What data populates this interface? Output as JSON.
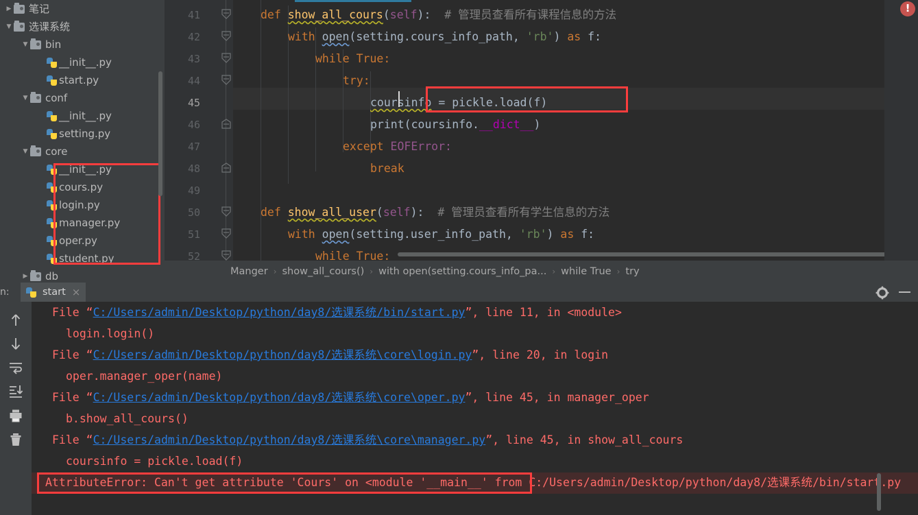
{
  "project_tree": {
    "items": [
      {
        "label": "笔记",
        "indent": 0,
        "twisty": "collapsed",
        "icon": "folder-icon"
      },
      {
        "label": "选课系统",
        "indent": 0,
        "twisty": "expanded",
        "icon": "folder-icon"
      },
      {
        "label": "bin",
        "indent": 1,
        "twisty": "expanded",
        "icon": "folder-icon"
      },
      {
        "label": "__init__.py",
        "indent": 2,
        "twisty": "none",
        "icon": "python-file-icon"
      },
      {
        "label": "start.py",
        "indent": 2,
        "twisty": "none",
        "icon": "python-file-icon"
      },
      {
        "label": "conf",
        "indent": 1,
        "twisty": "expanded",
        "icon": "folder-icon"
      },
      {
        "label": "__init__.py",
        "indent": 2,
        "twisty": "none",
        "icon": "python-file-icon"
      },
      {
        "label": "setting.py",
        "indent": 2,
        "twisty": "none",
        "icon": "python-file-icon"
      },
      {
        "label": "core",
        "indent": 1,
        "twisty": "expanded",
        "icon": "folder-icon"
      },
      {
        "label": "__init__.py",
        "indent": 2,
        "twisty": "none",
        "icon": "python-file-icon"
      },
      {
        "label": "cours.py",
        "indent": 2,
        "twisty": "none",
        "icon": "python-file-icon"
      },
      {
        "label": "login.py",
        "indent": 2,
        "twisty": "none",
        "icon": "python-file-icon"
      },
      {
        "label": "manager.py",
        "indent": 2,
        "twisty": "none",
        "icon": "python-file-icon"
      },
      {
        "label": "oper.py",
        "indent": 2,
        "twisty": "none",
        "icon": "python-file-icon"
      },
      {
        "label": "student.py",
        "indent": 2,
        "twisty": "none",
        "icon": "python-file-icon"
      },
      {
        "label": "db",
        "indent": 1,
        "twisty": "collapsed",
        "icon": "folder-icon"
      }
    ]
  },
  "editor": {
    "line_numbers": [
      "41",
      "42",
      "43",
      "44",
      "45",
      "46",
      "47",
      "48",
      "49",
      "50",
      "51",
      "52"
    ],
    "current_line": "45",
    "code_lines": [
      {
        "n": "41",
        "indent": 4,
        "segments": [
          {
            "t": "def ",
            "c": "kw"
          },
          {
            "t": "show_all_cours",
            "c": "fn squig"
          },
          {
            "t": "(",
            "c": "def"
          },
          {
            "t": "self",
            "c": "slf"
          },
          {
            "t": "):  ",
            "c": "def"
          },
          {
            "t": "# 管理员查看所有课程信息的方法",
            "c": "cmt"
          }
        ]
      },
      {
        "n": "42",
        "indent": 8,
        "segments": [
          {
            "t": "with ",
            "c": "kw"
          },
          {
            "t": "open",
            "c": "squig-w"
          },
          {
            "t": "(setting.cours_info_path, ",
            "c": "def"
          },
          {
            "t": "'rb'",
            "c": "str"
          },
          {
            "t": ") ",
            "c": "def"
          },
          {
            "t": "as ",
            "c": "kw"
          },
          {
            "t": "f:",
            "c": "def"
          }
        ]
      },
      {
        "n": "43",
        "indent": 12,
        "segments": [
          {
            "t": "while ",
            "c": "kw"
          },
          {
            "t": "True:",
            "c": "kw"
          }
        ]
      },
      {
        "n": "44",
        "indent": 16,
        "segments": [
          {
            "t": "try:",
            "c": "kw"
          }
        ]
      },
      {
        "n": "45",
        "indent": 20,
        "segments": [
          {
            "t": "coursinfo",
            "c": "def squig"
          },
          {
            "t": " = pickle.",
            "c": "def"
          },
          {
            "t": "load",
            "c": "def"
          },
          {
            "t": "(f)",
            "c": "def"
          }
        ]
      },
      {
        "n": "46",
        "indent": 20,
        "segments": [
          {
            "t": "print",
            "c": "def"
          },
          {
            "t": "(coursinfo.",
            "c": "def"
          },
          {
            "t": "__dict__",
            "c": "mag"
          },
          {
            "t": ")",
            "c": "def"
          }
        ]
      },
      {
        "n": "47",
        "indent": 16,
        "segments": [
          {
            "t": "except ",
            "c": "kw"
          },
          {
            "t": "EOFError:",
            "c": "slf"
          }
        ]
      },
      {
        "n": "48",
        "indent": 20,
        "segments": [
          {
            "t": "break",
            "c": "kw"
          }
        ]
      },
      {
        "n": "49",
        "indent": 0,
        "segments": []
      },
      {
        "n": "50",
        "indent": 4,
        "segments": [
          {
            "t": "def ",
            "c": "kw"
          },
          {
            "t": "show_all_user",
            "c": "fn squig"
          },
          {
            "t": "(",
            "c": "def"
          },
          {
            "t": "self",
            "c": "slf"
          },
          {
            "t": "):  ",
            "c": "def"
          },
          {
            "t": "# 管理员查看所有学生信息的方法",
            "c": "cmt"
          }
        ]
      },
      {
        "n": "51",
        "indent": 8,
        "segments": [
          {
            "t": "with ",
            "c": "kw"
          },
          {
            "t": "open",
            "c": "squig-w"
          },
          {
            "t": "(setting.user_info_path, ",
            "c": "def"
          },
          {
            "t": "'rb'",
            "c": "str"
          },
          {
            "t": ") ",
            "c": "def"
          },
          {
            "t": "as ",
            "c": "kw"
          },
          {
            "t": "f:",
            "c": "def"
          }
        ]
      },
      {
        "n": "52",
        "indent": 12,
        "segments": [
          {
            "t": "while ",
            "c": "kw"
          },
          {
            "t": "True:",
            "c": "kw"
          }
        ]
      }
    ],
    "error_badge_count": "!",
    "highlight_color": "#fc3d3d"
  },
  "breadcrumb": {
    "parts": [
      "Manger",
      "show_all_cours()",
      "with open(setting.cours_info_pa...",
      "while True",
      "try"
    ],
    "separator": "›"
  },
  "console": {
    "run_label": "n:",
    "tab_label": "start",
    "tab_close": "×",
    "gear_icon": "gear-icon",
    "minimize_icon": "minimize-icon",
    "toolbar_icons": [
      "arrow-up-icon",
      "arrow-down-icon",
      "soft-wrap-icon",
      "scroll-to-end-icon",
      "print-icon",
      "trash-icon"
    ],
    "lines": [
      {
        "indent": 2,
        "segments": [
          {
            "t": "File ",
            "c": "c-red"
          },
          {
            "t": "“",
            "c": "c-red"
          },
          {
            "t": "C:/Users/admin/Desktop/python/day8/选课系统/bin/start.py",
            "c": "c-link"
          },
          {
            "t": "”, line 11, in <module>",
            "c": "c-red"
          }
        ]
      },
      {
        "indent": 4,
        "segments": [
          {
            "t": "login.login()",
            "c": "c-red"
          }
        ]
      },
      {
        "indent": 2,
        "segments": [
          {
            "t": "File ",
            "c": "c-red"
          },
          {
            "t": "“",
            "c": "c-red"
          },
          {
            "t": "C:/Users/admin/Desktop/python/day8/选课系统\\core\\login.py",
            "c": "c-link"
          },
          {
            "t": "”, line 20, in login",
            "c": "c-red"
          }
        ]
      },
      {
        "indent": 4,
        "segments": [
          {
            "t": "oper.manager_oper(name)",
            "c": "c-red"
          }
        ]
      },
      {
        "indent": 2,
        "segments": [
          {
            "t": "File ",
            "c": "c-red"
          },
          {
            "t": "“",
            "c": "c-red"
          },
          {
            "t": "C:/Users/admin/Desktop/python/day8/选课系统\\core\\oper.py",
            "c": "c-link"
          },
          {
            "t": "”, line 45, in manager_oper",
            "c": "c-red"
          }
        ]
      },
      {
        "indent": 4,
        "segments": [
          {
            "t": "b.show_all_cours()",
            "c": "c-red"
          }
        ]
      },
      {
        "indent": 2,
        "segments": [
          {
            "t": "File ",
            "c": "c-red"
          },
          {
            "t": "“",
            "c": "c-red"
          },
          {
            "t": "C:/Users/admin/Desktop/python/day8/选课系统\\core\\manager.py",
            "c": "c-link"
          },
          {
            "t": "”, line 45, in show_all_cours",
            "c": "c-red"
          }
        ]
      },
      {
        "indent": 4,
        "segments": [
          {
            "t": "coursinfo = pickle.load(f)",
            "c": "c-red"
          }
        ]
      },
      {
        "indent": 1,
        "segments": [
          {
            "t": "AttributeError: Can't get attribute 'Cours' on <module '__main__' from ",
            "c": "c-red"
          },
          {
            "t": "C:/Users/admin/Desktop/python/day8/选课系统/bin/start.py",
            "c": "c-red"
          }
        ]
      }
    ]
  }
}
